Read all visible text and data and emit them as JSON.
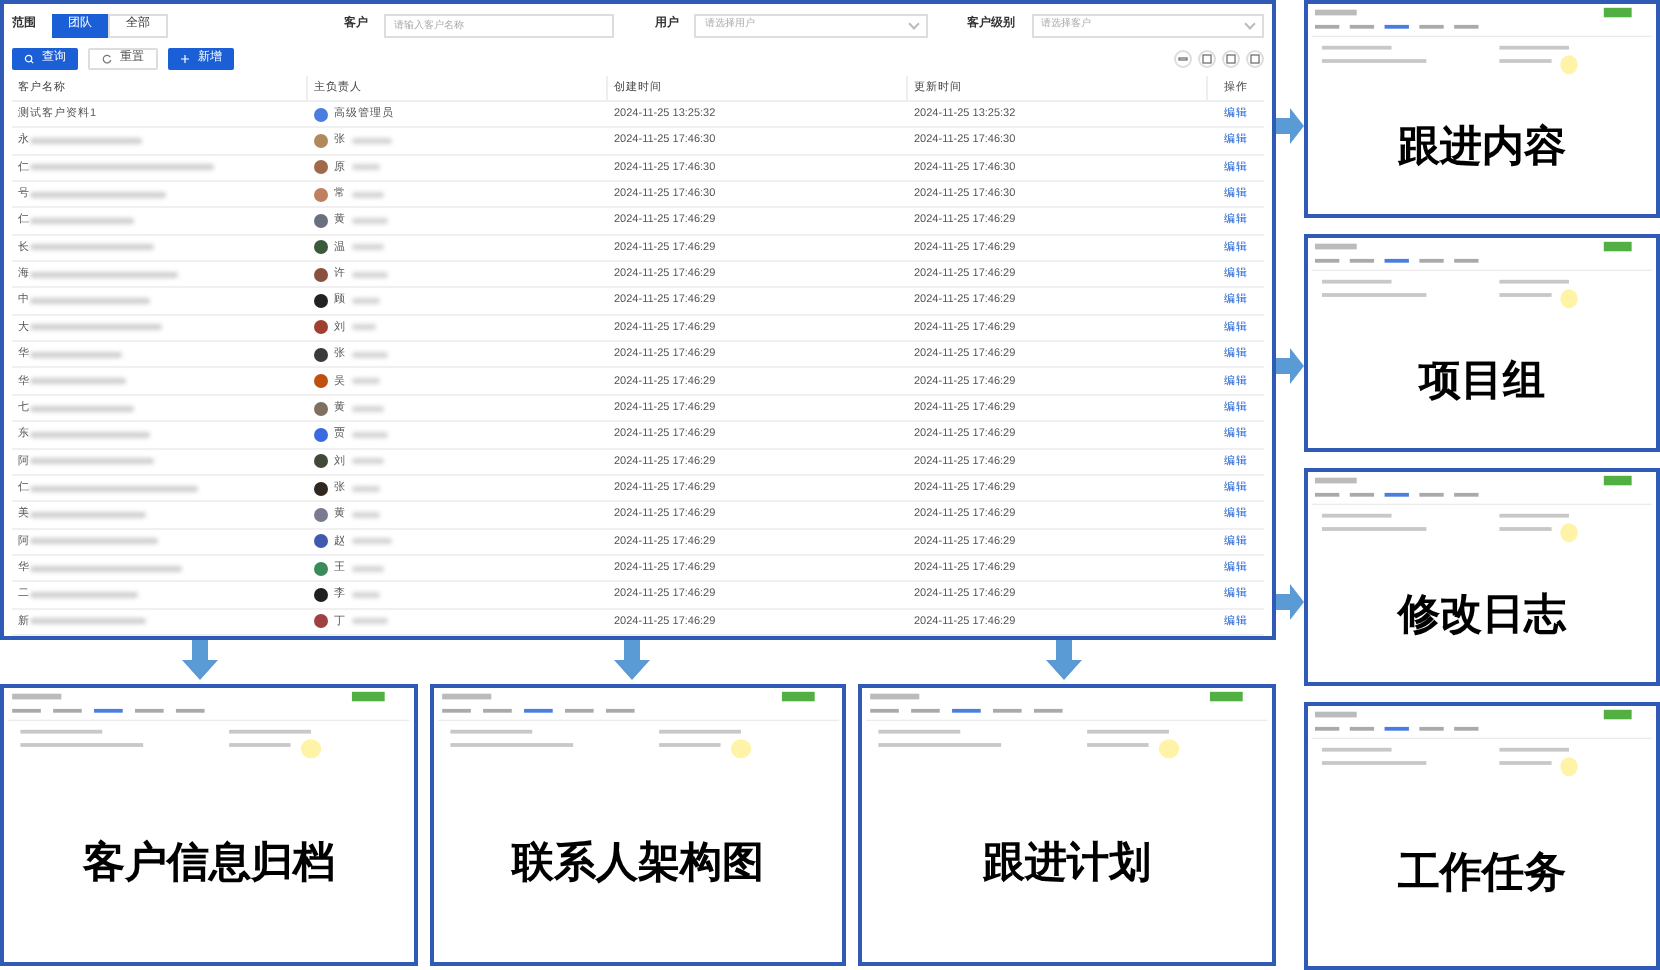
{
  "filters": {
    "scope_label": "范围",
    "scope_tabs": [
      {
        "label": "团队",
        "selected": true
      },
      {
        "label": "全部",
        "selected": false
      }
    ],
    "customer_label": "客户",
    "customer_placeholder": "请输入客户名称",
    "user_label": "用户",
    "user_placeholder": "请选择用户",
    "level_label": "客户级别",
    "level_placeholder": "请选择客户"
  },
  "buttons": [
    {
      "label": "查询",
      "kind": "query"
    },
    {
      "label": "重置",
      "kind": "reset"
    },
    {
      "label": "新增",
      "kind": "add"
    }
  ],
  "table": {
    "columns": [
      "客户名称",
      "主负责人",
      "创建时间",
      "更新时间",
      "操作"
    ],
    "rows": [
      {
        "name": "测试客户资料1",
        "owner": "高级管理员",
        "created": "2024-11-25 13:25:32",
        "updated": "2024-11-25 13:25:32",
        "action": "编辑"
      },
      {
        "name": "永",
        "owner": "张",
        "created": "2024-11-25 17:46:30",
        "updated": "2024-11-25 17:46:30",
        "action": "编辑"
      },
      {
        "name": "仁",
        "owner": "原",
        "created": "2024-11-25 17:46:30",
        "updated": "2024-11-25 17:46:30",
        "action": "编辑"
      },
      {
        "name": "号",
        "owner": "常",
        "created": "2024-11-25 17:46:30",
        "updated": "2024-11-25 17:46:30",
        "action": "编辑"
      },
      {
        "name": "仁",
        "owner": "黄",
        "created": "2024-11-25 17:46:29",
        "updated": "2024-11-25 17:46:29",
        "action": "编辑"
      },
      {
        "name": "长",
        "owner": "温",
        "created": "2024-11-25 17:46:29",
        "updated": "2024-11-25 17:46:29",
        "action": "编辑"
      },
      {
        "name": "海",
        "owner": "许",
        "created": "2024-11-25 17:46:29",
        "updated": "2024-11-25 17:46:29",
        "action": "编辑"
      },
      {
        "name": "中",
        "owner": "顾",
        "created": "2024-11-25 17:46:29",
        "updated": "2024-11-25 17:46:29",
        "action": "编辑"
      },
      {
        "name": "大",
        "owner": "刘",
        "created": "2024-11-25 17:46:29",
        "updated": "2024-11-25 17:46:29",
        "action": "编辑"
      },
      {
        "name": "华",
        "owner": "张",
        "created": "2024-11-25 17:46:29",
        "updated": "2024-11-25 17:46:29",
        "action": "编辑"
      },
      {
        "name": "华",
        "owner": "吴",
        "created": "2024-11-25 17:46:29",
        "updated": "2024-11-25 17:46:29",
        "action": "编辑"
      },
      {
        "name": "七",
        "owner": "黄",
        "created": "2024-11-25 17:46:29",
        "updated": "2024-11-25 17:46:29",
        "action": "编辑"
      },
      {
        "name": "东",
        "owner": "贾",
        "created": "2024-11-25 17:46:29",
        "updated": "2024-11-25 17:46:29",
        "action": "编辑"
      },
      {
        "name": "阿",
        "owner": "刘",
        "created": "2024-11-25 17:46:29",
        "updated": "2024-11-25 17:46:29",
        "action": "编辑"
      },
      {
        "name": "仁",
        "owner": "张",
        "created": "2024-11-25 17:46:29",
        "updated": "2024-11-25 17:46:29",
        "action": "编辑"
      },
      {
        "name": "美",
        "owner": "黄",
        "created": "2024-11-25 17:46:29",
        "updated": "2024-11-25 17:46:29",
        "action": "编辑"
      },
      {
        "name": "阿",
        "owner": "赵",
        "created": "2024-11-25 17:46:29",
        "updated": "2024-11-25 17:46:29",
        "action": "编辑"
      },
      {
        "name": "华",
        "owner": "王",
        "created": "2024-11-25 17:46:29",
        "updated": "2024-11-25 17:46:29",
        "action": "编辑"
      },
      {
        "name": "二",
        "owner": "李",
        "created": "2024-11-25 17:46:29",
        "updated": "2024-11-25 17:46:29",
        "action": "编辑"
      },
      {
        "name": "新",
        "owner": "丁",
        "created": "2024-11-25 17:46:29",
        "updated": "2024-11-25 17:46:29",
        "action": "编辑"
      }
    ]
  },
  "side_screens": [
    {
      "caption": "跟进内容"
    },
    {
      "caption": "项目组"
    },
    {
      "caption": "修改日志"
    },
    {
      "caption": "工作任务"
    }
  ],
  "bottom_screens": [
    {
      "caption": "客户信息归档"
    },
    {
      "caption": "联系人架构图"
    },
    {
      "caption": "跟进计划"
    }
  ]
}
